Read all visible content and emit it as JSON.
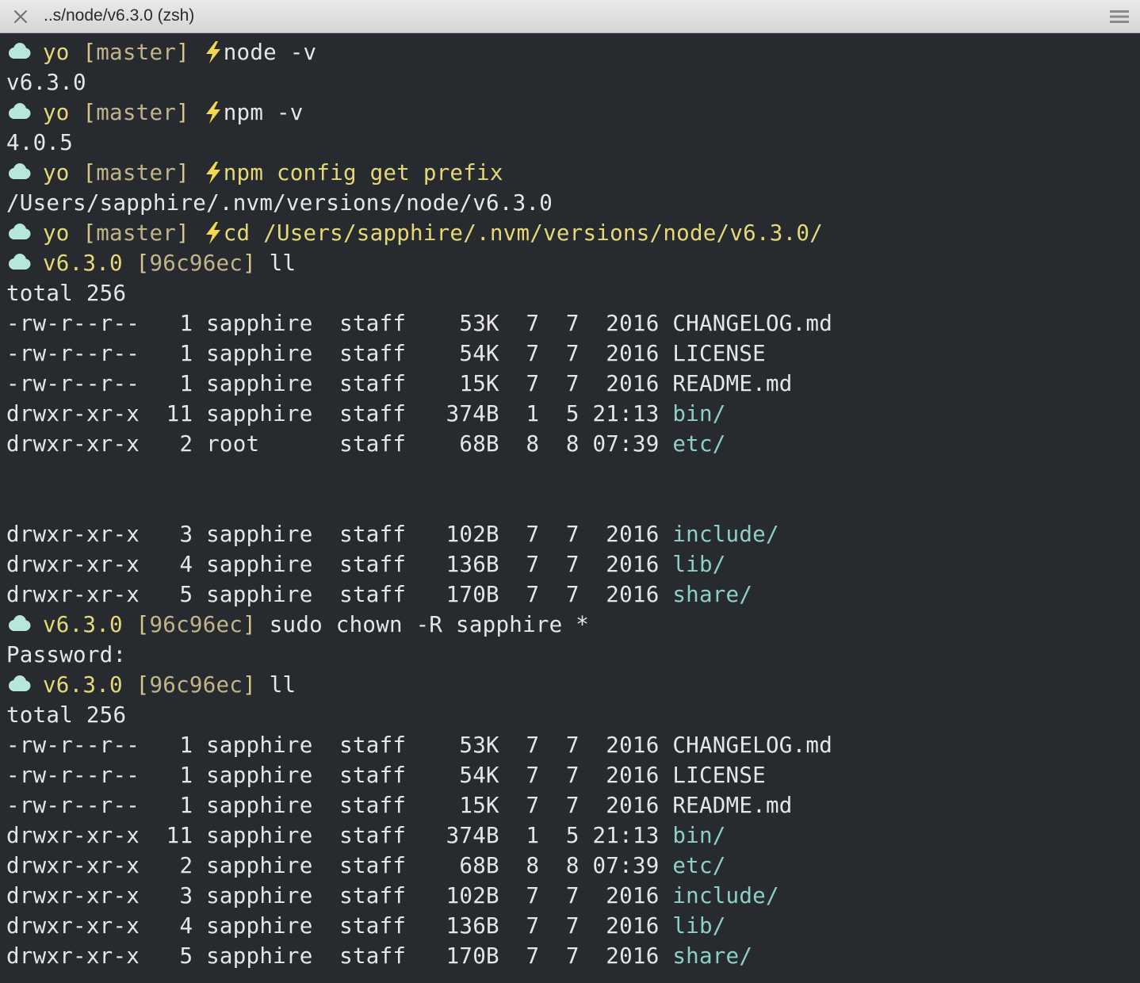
{
  "window": {
    "title": "..s/node/v6.3.0 (zsh)",
    "icons": {
      "close": "close-icon",
      "menu": "hamburger-menu-icon",
      "prompt": "cloud-icon",
      "separator": "lightning-icon"
    }
  },
  "colors": {
    "background": "#272a2e",
    "text": "#e6e6e6",
    "prompt_yellow": "#e5d977",
    "bracket_tan": "#d8c68a",
    "branch": "#c1b489",
    "dir_cyan": "#8fd0c4",
    "cloud": "#b7e6dc",
    "bolt": "#f1d84c"
  },
  "terminal": {
    "lines": [
      {
        "type": "prompt",
        "dir": "yo",
        "branch": "master",
        "bolt": true,
        "command": "node -v",
        "cmd_color": "text"
      },
      {
        "type": "out",
        "segments": [
          {
            "t": "v6.3.0",
            "c": "text"
          }
        ]
      },
      {
        "type": "prompt",
        "dir": "yo",
        "branch": "master",
        "bolt": true,
        "command": "npm -v",
        "cmd_color": "text"
      },
      {
        "type": "out",
        "segments": [
          {
            "t": "4.0.5",
            "c": "text"
          }
        ]
      },
      {
        "type": "prompt",
        "dir": "yo",
        "branch": "master",
        "bolt": true,
        "command": "npm config get prefix",
        "cmd_color": "prompt_yellow"
      },
      {
        "type": "out",
        "segments": [
          {
            "t": "/Users/sapphire/.nvm/versions/node/v6.3.0",
            "c": "text"
          }
        ]
      },
      {
        "type": "prompt",
        "dir": "yo",
        "branch": "master",
        "bolt": true,
        "command": "cd /Users/sapphire/.nvm/versions/node/v6.3.0/",
        "cmd_color": "prompt_yellow"
      },
      {
        "type": "prompt",
        "dir": "v6.3.0",
        "branch": "96c96ec",
        "bolt": false,
        "command": "ll",
        "cmd_color": "text"
      },
      {
        "type": "out",
        "segments": [
          {
            "t": "total 256",
            "c": "text"
          }
        ]
      },
      {
        "type": "out",
        "segments": [
          {
            "t": "-rw-r--r--   1 sapphire  staff    53K  7  7  2016 ",
            "c": "text"
          },
          {
            "t": "CHANGELOG.md",
            "c": "text"
          }
        ]
      },
      {
        "type": "out",
        "segments": [
          {
            "t": "-rw-r--r--   1 sapphire  staff    54K  7  7  2016 ",
            "c": "text"
          },
          {
            "t": "LICENSE",
            "c": "text"
          }
        ]
      },
      {
        "type": "out",
        "segments": [
          {
            "t": "-rw-r--r--   1 sapphire  staff    15K  7  7  2016 ",
            "c": "text"
          },
          {
            "t": "README.md",
            "c": "text"
          }
        ]
      },
      {
        "type": "out",
        "segments": [
          {
            "t": "drwxr-xr-x  11 sapphire  staff   374B  1  5 21:13 ",
            "c": "text"
          },
          {
            "t": "bin/",
            "c": "dir_cyan"
          }
        ]
      },
      {
        "type": "out",
        "segments": [
          {
            "t": "drwxr-xr-x   2 root      staff    68B  8  8 07:39 ",
            "c": "text"
          },
          {
            "t": "etc/",
            "c": "dir_cyan"
          }
        ]
      },
      {
        "type": "blank"
      },
      {
        "type": "blank"
      },
      {
        "type": "out",
        "segments": [
          {
            "t": "drwxr-xr-x   3 sapphire  staff   102B  7  7  2016 ",
            "c": "text"
          },
          {
            "t": "include/",
            "c": "dir_cyan"
          }
        ]
      },
      {
        "type": "out",
        "segments": [
          {
            "t": "drwxr-xr-x   4 sapphire  staff   136B  7  7  2016 ",
            "c": "text"
          },
          {
            "t": "lib/",
            "c": "dir_cyan"
          }
        ]
      },
      {
        "type": "out",
        "segments": [
          {
            "t": "drwxr-xr-x   5 sapphire  staff   170B  7  7  2016 ",
            "c": "text"
          },
          {
            "t": "share/",
            "c": "dir_cyan"
          }
        ]
      },
      {
        "type": "prompt",
        "dir": "v6.3.0",
        "branch": "96c96ec",
        "bolt": false,
        "command": "sudo chown -R sapphire *",
        "cmd_color": "text"
      },
      {
        "type": "out",
        "segments": [
          {
            "t": "Password:",
            "c": "text"
          }
        ]
      },
      {
        "type": "prompt",
        "dir": "v6.3.0",
        "branch": "96c96ec",
        "bolt": false,
        "command": "ll",
        "cmd_color": "text"
      },
      {
        "type": "out",
        "segments": [
          {
            "t": "total 256",
            "c": "text"
          }
        ]
      },
      {
        "type": "out",
        "segments": [
          {
            "t": "-rw-r--r--   1 sapphire  staff    53K  7  7  2016 ",
            "c": "text"
          },
          {
            "t": "CHANGELOG.md",
            "c": "text"
          }
        ]
      },
      {
        "type": "out",
        "segments": [
          {
            "t": "-rw-r--r--   1 sapphire  staff    54K  7  7  2016 ",
            "c": "text"
          },
          {
            "t": "LICENSE",
            "c": "text"
          }
        ]
      },
      {
        "type": "out",
        "segments": [
          {
            "t": "-rw-r--r--   1 sapphire  staff    15K  7  7  2016 ",
            "c": "text"
          },
          {
            "t": "README.md",
            "c": "text"
          }
        ]
      },
      {
        "type": "out",
        "segments": [
          {
            "t": "drwxr-xr-x  11 sapphire  staff   374B  1  5 21:13 ",
            "c": "text"
          },
          {
            "t": "bin/",
            "c": "dir_cyan"
          }
        ]
      },
      {
        "type": "out",
        "segments": [
          {
            "t": "drwxr-xr-x   2 sapphire  staff    68B  8  8 07:39 ",
            "c": "text"
          },
          {
            "t": "etc/",
            "c": "dir_cyan"
          }
        ]
      },
      {
        "type": "out",
        "segments": [
          {
            "t": "drwxr-xr-x   3 sapphire  staff   102B  7  7  2016 ",
            "c": "text"
          },
          {
            "t": "include/",
            "c": "dir_cyan"
          }
        ]
      },
      {
        "type": "out",
        "segments": [
          {
            "t": "drwxr-xr-x   4 sapphire  staff   136B  7  7  2016 ",
            "c": "text"
          },
          {
            "t": "lib/",
            "c": "dir_cyan"
          }
        ]
      },
      {
        "type": "out",
        "segments": [
          {
            "t": "drwxr-xr-x   5 sapphire  staff   170B  7  7  2016 ",
            "c": "text"
          },
          {
            "t": "share/",
            "c": "dir_cyan"
          }
        ]
      }
    ]
  }
}
